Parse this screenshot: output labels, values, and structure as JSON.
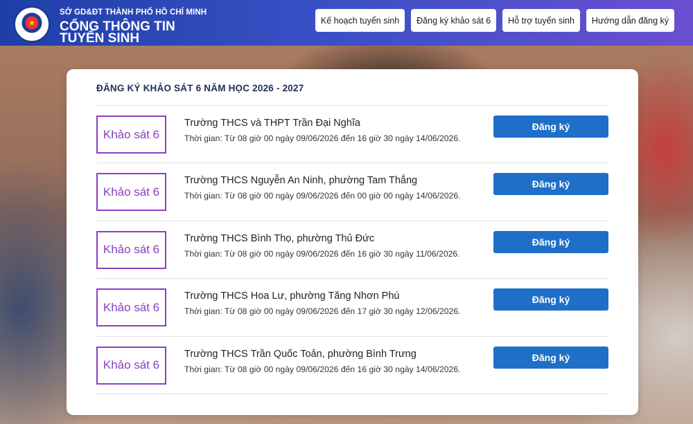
{
  "header": {
    "org": "SỞ GD&ĐT THÀNH PHỐ HỒ CHÍ MINH",
    "title": "CỔNG THÔNG TIN TUYỂN SINH",
    "nav": [
      "Kế hoạch tuyển sinh",
      "Đăng ký khảo sát 6",
      "Hỗ trợ tuyển sinh",
      "Hướng dẫn đăng ký"
    ]
  },
  "main": {
    "heading": "ĐĂNG KÝ KHẢO SÁT 6 NĂM HỌC 2026 - 2027",
    "rows": [
      {
        "tag": "Khảo sát 6",
        "school": "Trường THCS và THPT Trần Đại Nghĩa",
        "time": "Thời gian: Từ 08 giờ 00 ngày 09/06/2026 đến 16 giờ 30 ngày 14/06/2026.",
        "button": "Đăng ký"
      },
      {
        "tag": "Khảo sát 6",
        "school": "Trường THCS Nguyễn An Ninh, phường Tam Thắng",
        "time": "Thời gian: Từ 08 giờ 00 ngày 09/06/2026 đến 00 giờ 00 ngày 14/06/2026.",
        "button": "Đăng ký"
      },
      {
        "tag": "Khảo sát 6",
        "school": "Trường THCS Bình Thọ, phường Thủ Đức",
        "time": "Thời gian: Từ 08 giờ 00 ngày 09/06/2026 đến 16 giờ 30 ngày 11/06/2026.",
        "button": "Đăng ký"
      },
      {
        "tag": "Khảo sát 6",
        "school": "Trường THCS Hoa Lư, phường Tăng Nhơn Phú",
        "time": "Thời gian: Từ 08 giờ 00 ngày 09/06/2026 đến 17 giờ 30 ngày 12/06/2026.",
        "button": "Đăng ký"
      },
      {
        "tag": "Khảo sát 6",
        "school": "Trường THCS Trần Quốc Toản, phường Bình Trưng",
        "time": "Thời gian: Từ 08 giờ 00 ngày 09/06/2026 đến 16 giờ 30 ngày 14/06/2026.",
        "button": "Đăng ký"
      }
    ]
  },
  "icons": {
    "logo": "education-department-seal-icon"
  },
  "colors": {
    "header_start": "#1e3fa8",
    "header_end": "#6a4fd0",
    "tag_border": "#8a3ec0",
    "button_bg": "#1f6fc8",
    "heading_text": "#1f2c5a"
  }
}
